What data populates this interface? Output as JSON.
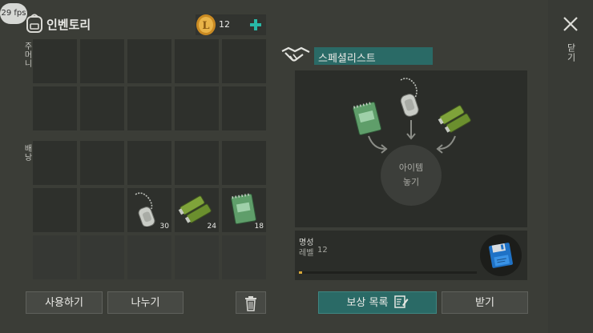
{
  "fps": "29 fps",
  "inventory": {
    "title": "인벤토리",
    "coins": "12"
  },
  "side_labels": {
    "pockets": "주머니",
    "backpack": "배낭"
  },
  "items": [
    {
      "name": "dog-tag",
      "count": "30"
    },
    {
      "name": "battery",
      "count": "24"
    },
    {
      "name": "notebook",
      "count": "18"
    }
  ],
  "buttons": {
    "use": "사용하기",
    "split": "나누기",
    "rewards": "보상 목록",
    "receive": "받기"
  },
  "specialist": {
    "title": "스페셜리스트",
    "drop_line1": "아이템",
    "drop_line2": "놓기",
    "reputation_label": "명성",
    "level_label": "레벨",
    "level_value": "12",
    "progress": 0.02
  },
  "close": {
    "label": "닫기"
  },
  "colors": {
    "accent": "#2a6a66",
    "coin": "#e0a838",
    "plus": "#28b8a6",
    "progress": "#d8a838"
  }
}
